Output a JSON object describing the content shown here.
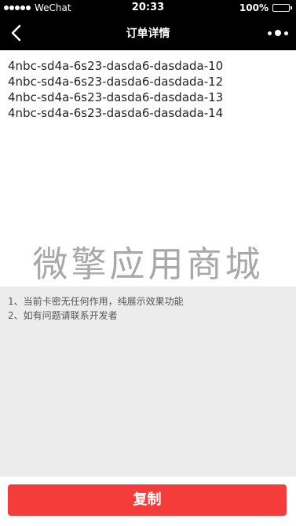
{
  "status_bar": {
    "carrier": "WeChat",
    "time": "20:33",
    "battery_percent": "100%",
    "battery_level": 1.0,
    "signal_bars": 5
  },
  "nav": {
    "title": "订单详情",
    "back_icon": "chevron-left-icon",
    "more_icon": "more-dots-icon"
  },
  "codes": [
    "4nbc-sd4a-6s23-dasda6-dasdada-10",
    "4nbc-sd4a-6s23-dasda6-dasdada-12",
    "4nbc-sd4a-6s23-dasda6-dasdada-13",
    "4nbc-sd4a-6s23-dasda6-dasdada-14"
  ],
  "watermark": "微擎应用商城",
  "notes": [
    "1、当前卡密无任何作用，纯展示效果功能",
    "2、如有问题请联系开发者"
  ],
  "footer": {
    "copy_label": "复制"
  },
  "colors": {
    "bar_background": "#000000",
    "notes_background": "#ececec",
    "button_red": "#f43d3a",
    "watermark_gray": "#a8a8a8"
  }
}
